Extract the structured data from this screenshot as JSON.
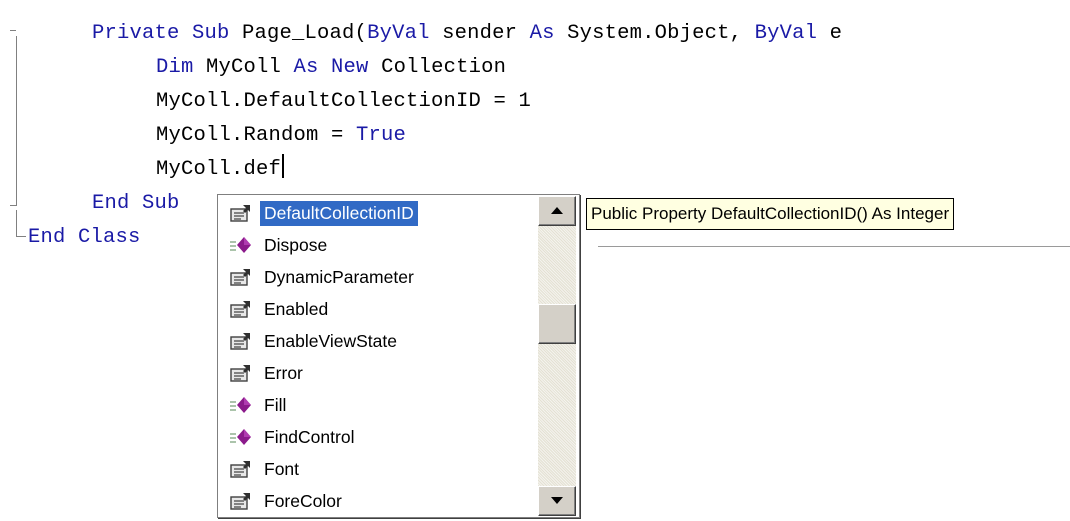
{
  "editor": {
    "lines": [
      {
        "parts": [
          {
            "t": "Private Sub ",
            "k": true
          },
          {
            "t": "Page_Load(",
            "k": false
          },
          {
            "t": "ByVal ",
            "k": true
          },
          {
            "t": "sender ",
            "k": false
          },
          {
            "t": "As ",
            "k": true
          },
          {
            "t": "System.Object, ",
            "k": false
          },
          {
            "t": "ByVal ",
            "k": true
          },
          {
            "t": "e ",
            "k": false
          }
        ]
      },
      {
        "parts": [
          {
            "t": "Dim ",
            "k": true
          },
          {
            "t": "MyColl ",
            "k": false
          },
          {
            "t": "As ",
            "k": true
          },
          {
            "t": "New ",
            "k": true
          },
          {
            "t": "Collection",
            "k": false
          }
        ]
      },
      {
        "parts": [
          {
            "t": "MyColl.DefaultCollectionID = 1",
            "k": false
          }
        ]
      },
      {
        "parts": [
          {
            "t": "MyColl.Random = ",
            "k": false
          },
          {
            "t": "True",
            "k": true
          }
        ]
      },
      {
        "parts": [
          {
            "t": "MyColl.def",
            "k": false
          }
        ]
      },
      {
        "parts": [
          {
            "t": "End Sub",
            "k": true
          }
        ]
      },
      {
        "parts": [
          {
            "t": "End Class",
            "k": true
          }
        ]
      }
    ]
  },
  "completion": {
    "items": [
      {
        "label": "DefaultCollectionID",
        "icon": "property-icon",
        "selected": true
      },
      {
        "label": "Dispose",
        "icon": "method-icon",
        "selected": false
      },
      {
        "label": "DynamicParameter",
        "icon": "property-icon",
        "selected": false
      },
      {
        "label": "Enabled",
        "icon": "property-icon",
        "selected": false
      },
      {
        "label": "EnableViewState",
        "icon": "property-icon",
        "selected": false
      },
      {
        "label": "Error",
        "icon": "property-icon",
        "selected": false
      },
      {
        "label": "Fill",
        "icon": "method-icon",
        "selected": false
      },
      {
        "label": "FindControl",
        "icon": "method-icon",
        "selected": false
      },
      {
        "label": "Font",
        "icon": "property-icon",
        "selected": false
      },
      {
        "label": "ForeColor",
        "icon": "property-icon",
        "selected": false
      }
    ],
    "colors": {
      "selection": "#316ac5",
      "method": "#8b1a8b",
      "keyword": "#1a1aa6"
    }
  },
  "tooltip": {
    "text": "Public Property DefaultCollectionID() As Integer"
  }
}
